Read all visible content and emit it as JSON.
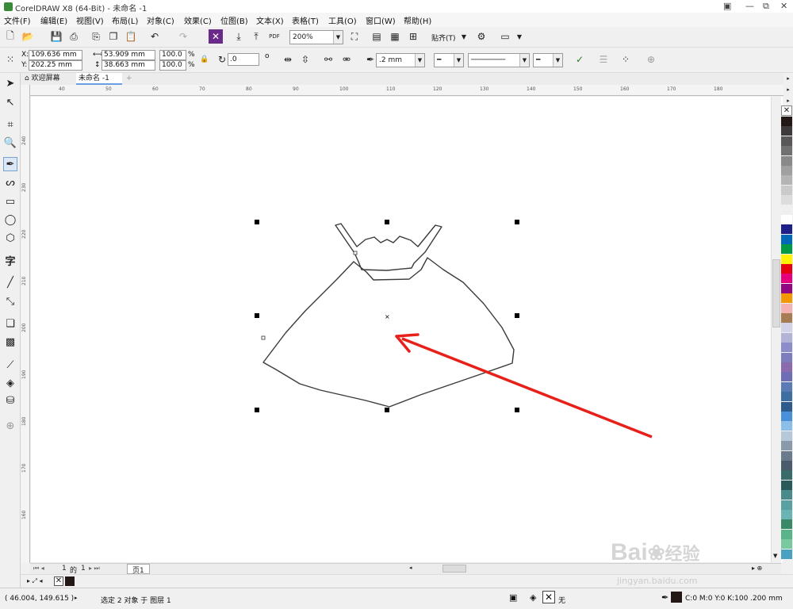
{
  "window": {
    "title": "CorelDRAW X8 (64-Bit) - 未命名 -1",
    "controls": [
      "⧉",
      "—",
      "☐",
      "✕"
    ]
  },
  "menu": [
    "文件(F)",
    "编辑(E)",
    "视图(V)",
    "布局(L)",
    "对象(C)",
    "效果(C)",
    "位图(B)",
    "文本(X)",
    "表格(T)",
    "工具(O)",
    "窗口(W)",
    "帮助(H)"
  ],
  "toolbar": {
    "zoom": "200%",
    "snap_label": "贴齐(T)",
    "pdf_label": "PDF"
  },
  "propbar": {
    "x_label": "X:",
    "x_value": "109.636 mm",
    "y_label": "Y:",
    "y_value": "202.25 mm",
    "w_value": "53.909 mm",
    "h_value": "38.663 mm",
    "sx_value": "100.0",
    "sy_value": "100.0",
    "pct": "%",
    "angle_value": ".0",
    "deg": "o",
    "outline_width": ".2 mm"
  },
  "tabs": {
    "welcome": "欢迎屏幕",
    "doc": "未命名 -1"
  },
  "ruler": {
    "h": [
      "40",
      "50",
      "60",
      "70",
      "80",
      "90",
      "100",
      "110",
      "120",
      "130",
      "140",
      "150",
      "160",
      "170",
      "180"
    ],
    "v": [
      "240",
      "230",
      "220",
      "210",
      "200",
      "190",
      "180",
      "170",
      "160"
    ]
  },
  "pagebar": {
    "page_index": "1",
    "of": "的",
    "page_total": "1",
    "page_tab": "页1"
  },
  "status": {
    "coords": "( 46.004, 149.615 )",
    "selection": "选定 2 对象 于 图层 1",
    "fill_none": "无",
    "outline_info": "C:0 M:0 Y:0 K:100  .200 mm"
  },
  "watermark": {
    "logo": "Bai",
    "logo2": "经验",
    "url": "jingyan.baidu.com"
  },
  "palette": [
    "#231815",
    "#3e3a39",
    "#595757",
    "#727171",
    "#898989",
    "#9fa0a0",
    "#b5b5b6",
    "#c9caca",
    "#dcdddd",
    "#efefef",
    "#ffffff",
    "#1d2088",
    "#0068b7",
    "#009944",
    "#fff100",
    "#e60012",
    "#e4007f",
    "#920783",
    "#f39800",
    "#f5b2b2",
    "#a67c52",
    "#d3d3e8",
    "#b3b3d6",
    "#8c8cc8",
    "#7d7dbe",
    "#8b6bab",
    "#6e6eb4",
    "#5b7bb4",
    "#3f6ea0",
    "#2e5a8c",
    "#4a90d9",
    "#8cbfe8",
    "#b4c8d8",
    "#8a9aa8",
    "#6b7b8b",
    "#4b5b6b",
    "#3a6b6b",
    "#2a5a5a",
    "#4a8a8a",
    "#5aa0a0",
    "#6ab4b4",
    "#3a8a6a",
    "#5ab48a",
    "#7ac8a0",
    "#4aa0c0"
  ]
}
